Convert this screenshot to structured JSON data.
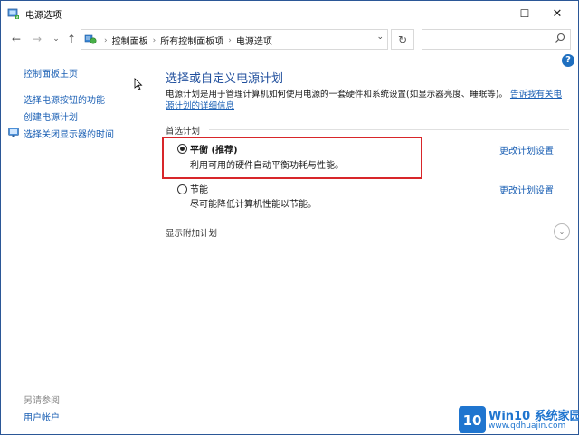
{
  "window": {
    "title": "电源选项"
  },
  "address": {
    "crumbs": [
      "控制面板",
      "所有控制面板项",
      "电源选项"
    ],
    "search_placeholder": ""
  },
  "left_pane": {
    "home_link": "控制面板主页",
    "links": [
      "选择电源按钮的功能",
      "创建电源计划",
      "选择关闭显示器的时间"
    ],
    "see_also_label": "另请参阅",
    "see_also_links": [
      "用户帐户"
    ]
  },
  "main": {
    "title": "选择或自定义电源计划",
    "description": "电源计划是用于管理计算机如何使用电源的一套硬件和系统设置(如显示器亮度、睡眠等)。",
    "description_link": "告诉我有关电源计划的详细信息",
    "preferred_heading": "首选计划",
    "plans": [
      {
        "name": "平衡 (推荐)",
        "desc": "利用可用的硬件自动平衡功耗与性能。",
        "selected": true,
        "change_label": "更改计划设置"
      },
      {
        "name": "节能",
        "desc": "尽可能降低计算机性能以节能。",
        "selected": false,
        "change_label": "更改计划设置"
      }
    ],
    "show_additional": "显示附加计划"
  },
  "watermark": {
    "logo_text": "10",
    "line1": "Win10 系统家园",
    "line2": "www.qdhuajin.com"
  },
  "colors": {
    "link": "#1a5fb4",
    "title": "#1f4e9c",
    "highlight": "#d8262a"
  }
}
